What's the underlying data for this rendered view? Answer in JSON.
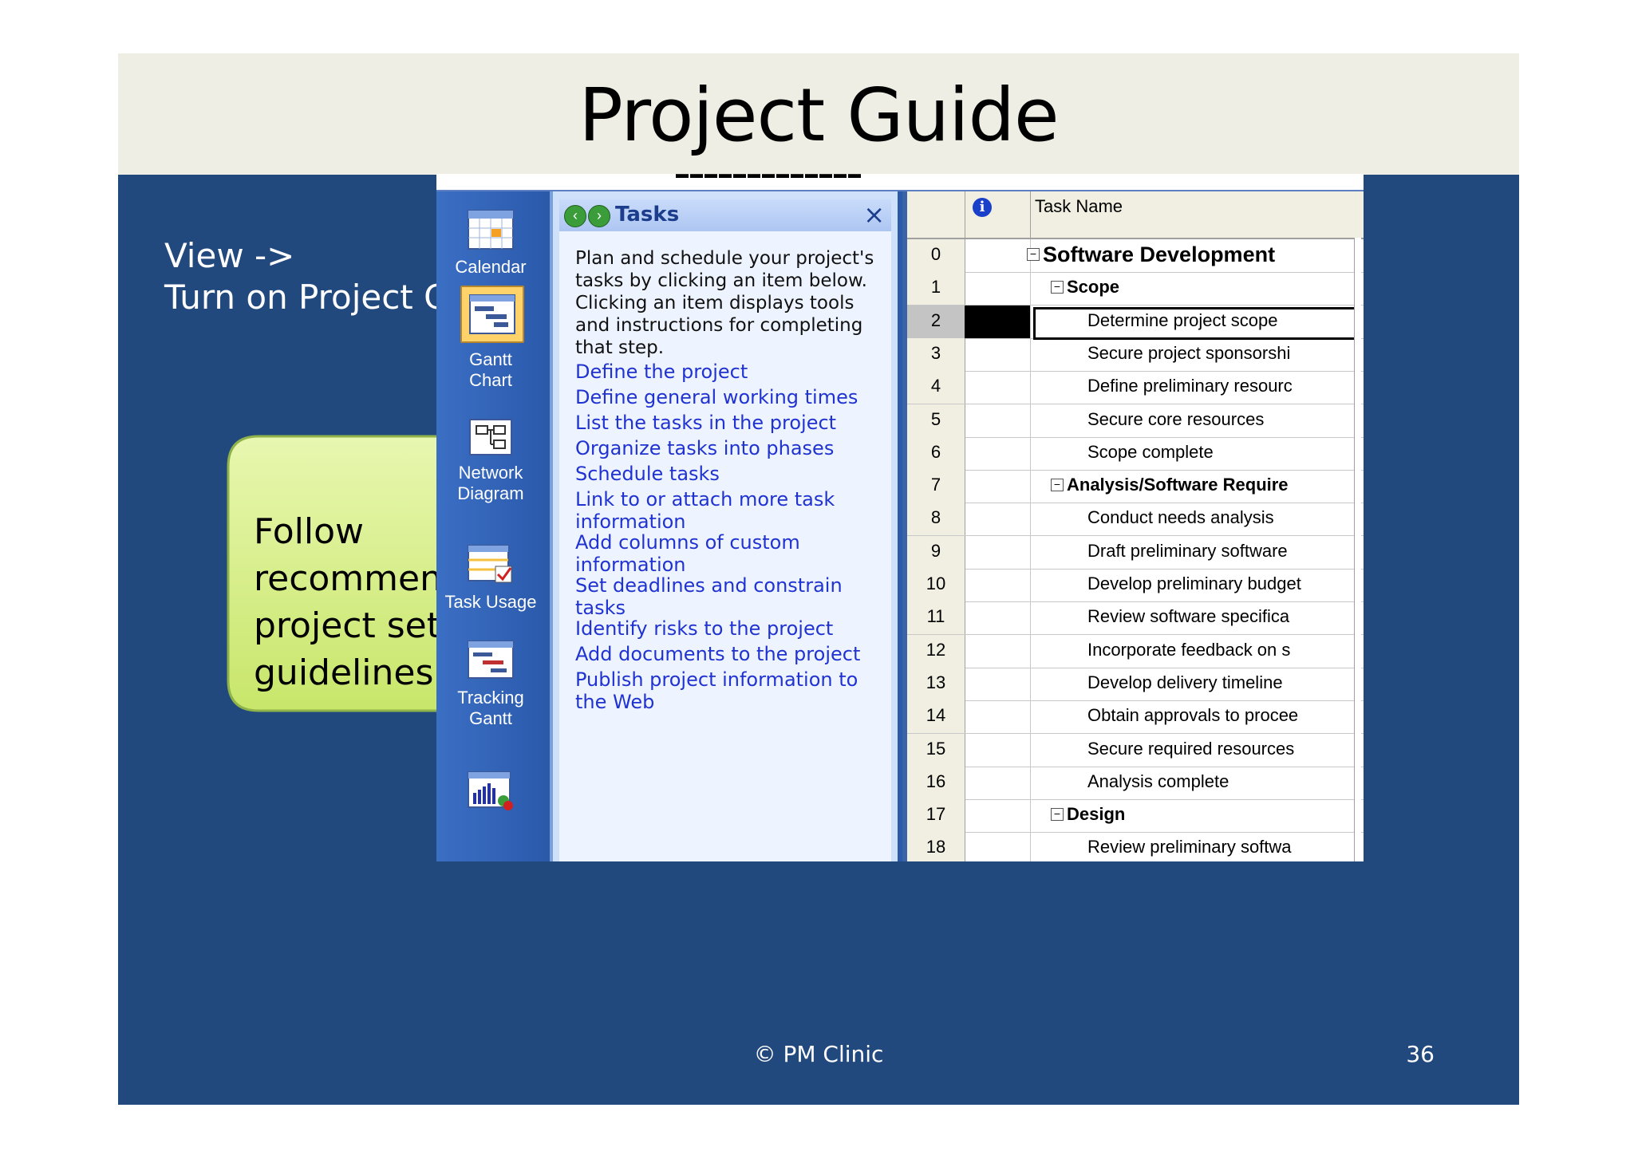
{
  "slide": {
    "title": "Project Guide",
    "instruction_line1": "View ->",
    "instruction_line2": "Turn on Project Guide",
    "callout_lines": [
      "Follow",
      "recommended",
      "project setup",
      "guidelines"
    ],
    "footer": "© PM Clinic",
    "page_number": "36"
  },
  "viewbar": {
    "items": [
      {
        "label_lines": [
          "Calendar"
        ],
        "icon": "calendar-icon"
      },
      {
        "label_lines": [
          "Gantt",
          "Chart"
        ],
        "icon": "gantt-chart-icon",
        "active": true
      },
      {
        "label_lines": [
          "Network",
          "Diagram"
        ],
        "icon": "network-diagram-icon"
      },
      {
        "label_lines": [
          "Task Usage"
        ],
        "icon": "task-usage-icon"
      },
      {
        "label_lines": [
          "Tracking",
          "Gantt"
        ],
        "icon": "tracking-gantt-icon"
      },
      {
        "label_lines": [
          ""
        ],
        "icon": "resource-graph-icon"
      }
    ]
  },
  "tasks_pane": {
    "title": "Tasks",
    "intro": "Plan and schedule your project's tasks by clicking an item below. Clicking an item displays tools and instructions for completing that step.",
    "links": [
      "Define the project",
      "Define general working times",
      "List the tasks in the project",
      "Organize tasks into phases",
      "Schedule tasks",
      "Link to or attach more task information",
      "Add columns of custom information",
      "Set deadlines and constrain tasks",
      "Identify risks to the project",
      "Add documents to the project",
      "Publish project information to the Web"
    ]
  },
  "grid": {
    "header_name": "Task Name",
    "rows": [
      {
        "id": "0",
        "name": "Software Development",
        "level": 0,
        "summary": true
      },
      {
        "id": "1",
        "name": "Scope",
        "level": 1,
        "summary": true
      },
      {
        "id": "2",
        "name": "Determine project scope",
        "level": 2,
        "selected": true
      },
      {
        "id": "3",
        "name": "Secure project sponsorshi",
        "level": 2
      },
      {
        "id": "4",
        "name": "Define preliminary resourc",
        "level": 2
      },
      {
        "id": "5",
        "name": "Secure core resources",
        "level": 2
      },
      {
        "id": "6",
        "name": "Scope complete",
        "level": 2
      },
      {
        "id": "7",
        "name": "Analysis/Software Require",
        "level": 1,
        "summary": true
      },
      {
        "id": "8",
        "name": "Conduct needs analysis",
        "level": 2
      },
      {
        "id": "9",
        "name": "Draft preliminary software",
        "level": 2
      },
      {
        "id": "10",
        "name": "Develop preliminary budget",
        "level": 2
      },
      {
        "id": "11",
        "name": "Review software specifica",
        "level": 2
      },
      {
        "id": "12",
        "name": "Incorporate feedback on s",
        "level": 2
      },
      {
        "id": "13",
        "name": "Develop delivery timeline",
        "level": 2
      },
      {
        "id": "14",
        "name": "Obtain approvals to procee",
        "level": 2
      },
      {
        "id": "15",
        "name": "Secure required resources",
        "level": 2
      },
      {
        "id": "16",
        "name": "Analysis complete",
        "level": 2
      },
      {
        "id": "17",
        "name": "Design",
        "level": 1,
        "summary": true
      },
      {
        "id": "18",
        "name": "Review preliminary softwa",
        "level": 2
      }
    ]
  },
  "colors": {
    "slide_bg": "#22497e",
    "title_band": "#eeeee4",
    "callout_fill": "#d6f08a",
    "link_blue": "#2033d0"
  }
}
